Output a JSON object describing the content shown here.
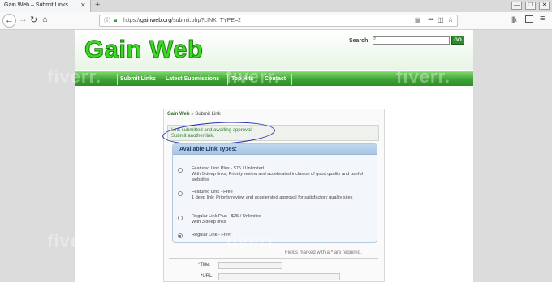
{
  "browser": {
    "tab_title": "Gain Web – Submit Links",
    "tab_close_icon": "close-icon",
    "new_tab_icon": "plus-icon",
    "url_host": "gainweb.org",
    "url_prefix": "https://",
    "url_path": "/submit.php?LINK_TYPE=2",
    "window_buttons": [
      "—",
      "❐",
      "✕"
    ]
  },
  "header": {
    "logo": "Gain Web",
    "search_label": "Search:",
    "search_value": "",
    "search_button": "GO"
  },
  "menu": {
    "items": [
      "Submit Links",
      "Latest Submissions",
      "Top Hits",
      "Contact"
    ]
  },
  "main": {
    "breadcrumb_site": "Gain Web",
    "breadcrumb_sep": "»",
    "breadcrumb_page": "Submit Link",
    "notice_line1": "Link submitted and awaiting approval.",
    "notice_line2": "Submit another link.",
    "types_title": "Available Link Types:",
    "options": [
      {
        "line1": "Featured Link Plus - $75 / Unlimited",
        "line2": "With 5 deep links; Priority review and accelerated inclusion of good quality and useful websites",
        "selected": false
      },
      {
        "line1": "Featured Link - Free",
        "line2": "1 deep link; Priority review and accelerated approval for satisfactory quality sites",
        "selected": false
      },
      {
        "line1": "Regular Link Plus - $25 / Unlimited",
        "line2": "With 3 deep links",
        "selected": false
      },
      {
        "line1": "Regular Link - Free",
        "line2": "",
        "selected": true
      }
    ],
    "fields_note_a": "Fields marked with a",
    "fields_note_star": "*",
    "fields_note_b": "are required.",
    "form": {
      "title_label": "*Title:",
      "title_value": "",
      "url_label": "*URL:",
      "url_value": ""
    }
  },
  "watermark": "fiverr.",
  "colors": {
    "logo_green": "#3adb20",
    "menu_green": "#3da234",
    "notice_text": "#35813a",
    "annotation_blue": "#1e2fb0"
  }
}
